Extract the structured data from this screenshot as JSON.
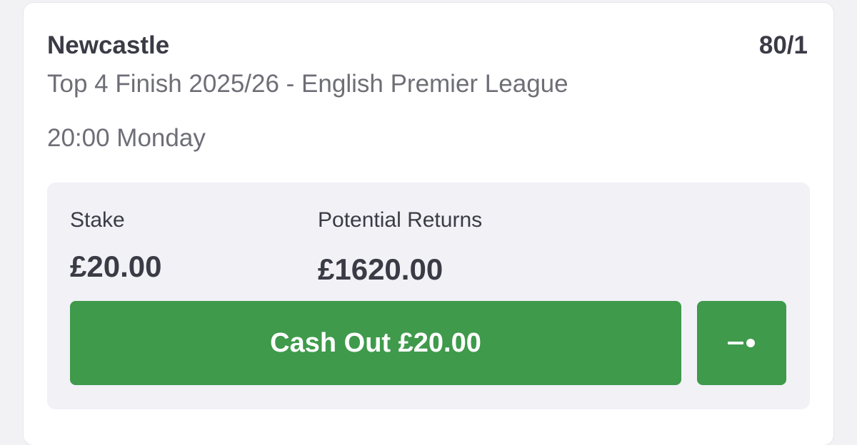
{
  "bet": {
    "selection": "Newcastle",
    "odds": "80/1",
    "market": "Top 4 Finish 2025/26 - English Premier League",
    "time": "20:00 Monday"
  },
  "panel": {
    "stake_label": "Stake",
    "stake_value": "£20.00",
    "returns_label": "Potential Returns",
    "returns_value": "£1620.00",
    "cashout_label": "Cash Out £20.00",
    "slider_icon": "partial-cashout-slider-icon"
  },
  "colors": {
    "accent_green": "#3f9a4b",
    "text_dark": "#3b3b46",
    "text_muted": "#6e6e77",
    "panel_bg": "#f1f1f6"
  }
}
